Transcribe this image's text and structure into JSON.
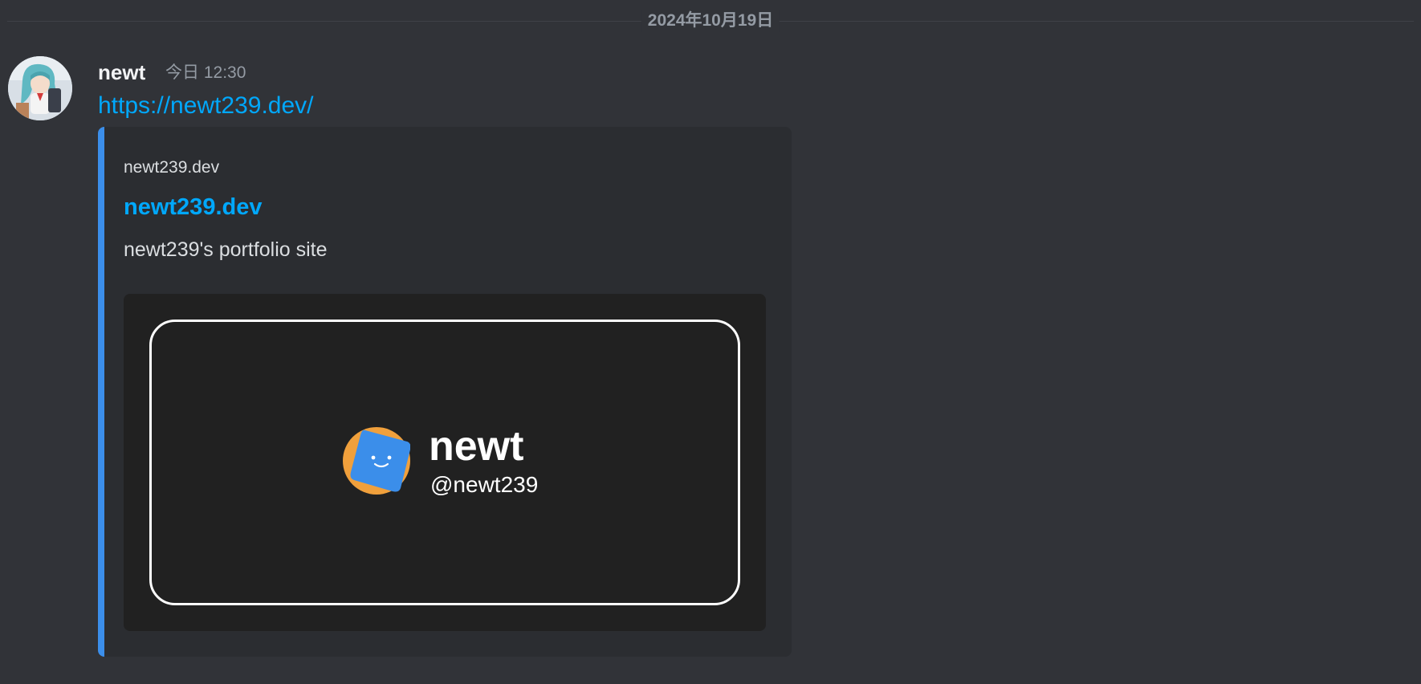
{
  "date_divider": "2024年10月19日",
  "message": {
    "username": "newt",
    "timestamp": "今日 12:30",
    "link": "https://newt239.dev/"
  },
  "embed": {
    "provider": "newt239.dev",
    "title": "newt239.dev",
    "description": "newt239's portfolio site",
    "accent_color": "#3b8eea",
    "image": {
      "name": "newt",
      "handle": "@newt239"
    }
  },
  "colors": {
    "background": "#313338",
    "embed_background": "#2b2d31",
    "link": "#00a8fc",
    "muted_text": "#949ba4"
  },
  "icons": {
    "avatar": "anime-character-avatar",
    "logo": "smiley-face-logo"
  }
}
